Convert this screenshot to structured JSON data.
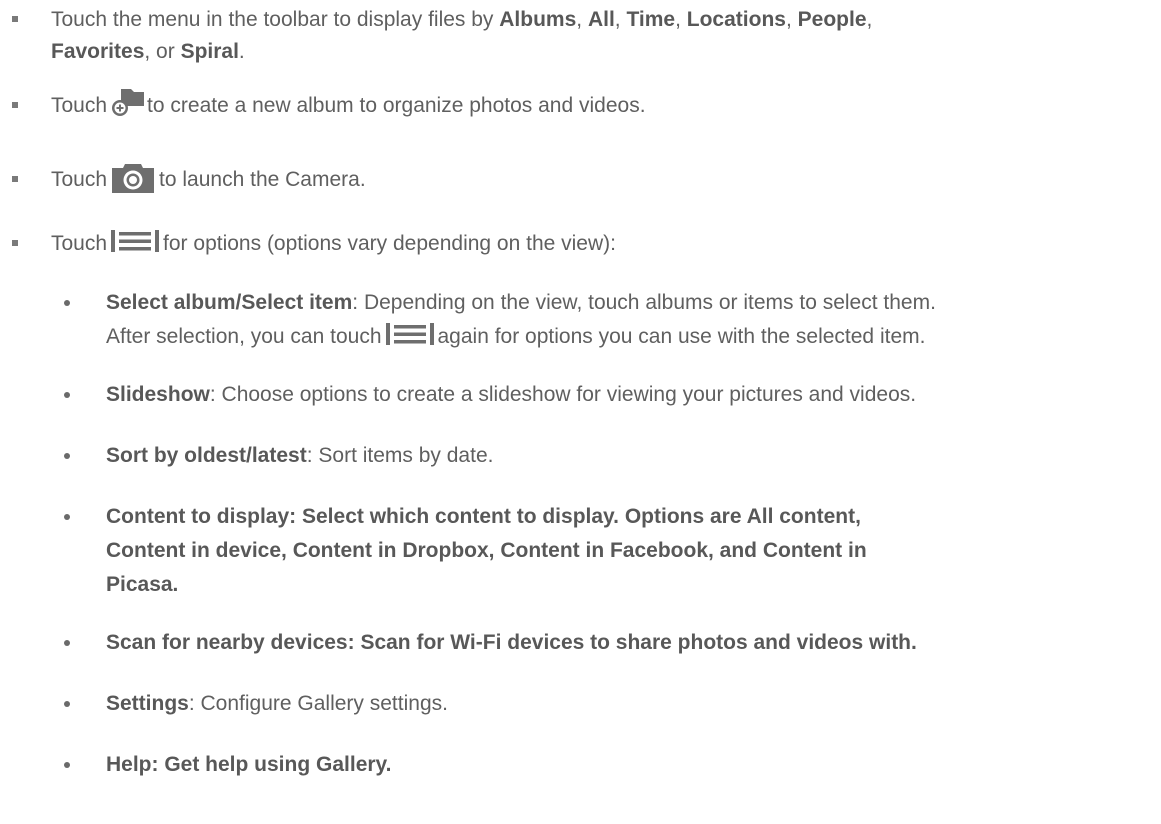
{
  "colors": {
    "text": "#5f5f5f",
    "icon": "#6e6e6e"
  },
  "item1": {
    "pre": "Touch the menu in the toolbar to display files by ",
    "albums": "Albums",
    "sep1": ", ",
    "all": "All",
    "sep2": ", ",
    "time": "Time",
    "sep3": ", ",
    "locations": "Locations",
    "sep4": ", ",
    "people": "People",
    "sep5": ",",
    "favorites": "Favorites",
    "sep6": ", or ",
    "spiral": "Spiral",
    "end": "."
  },
  "item2": {
    "pre": "Touch",
    "icon": "new-album-icon",
    "post": "to create a new album to organize photos and videos."
  },
  "item3": {
    "pre": "Touch",
    "icon": "camera-icon",
    "post": "to launch the Camera."
  },
  "item4": {
    "pre": "Touch",
    "icon": "menu-icon",
    "post": "for options (options vary depending on the view):"
  },
  "sub": {
    "select": {
      "term": "Select album/Select item",
      "desc": ": Depending on the view, touch albums or items to select them.",
      "line2_pre": "After selection, you can touch",
      "line2_post": "again for options you can use with the selected item."
    },
    "slideshow": {
      "term": "Slideshow",
      "desc": ": Choose options to create a slideshow for viewing your pictures and videos."
    },
    "sort": {
      "term": "Sort by oldest/latest",
      "desc": ": Sort items by date."
    },
    "content": {
      "line1": "Content to display: Select which content to display. Options are All content,",
      "line2": "Content in device, Content in Dropbox, Content in Facebook, and Content in",
      "line3": "Picasa."
    },
    "scan": {
      "text": "Scan for nearby devices: Scan for Wi-Fi devices to share photos and videos with."
    },
    "settings": {
      "term": "Settings",
      "desc": ": Configure Gallery settings."
    },
    "help": {
      "text": "Help: Get help using Gallery."
    }
  }
}
